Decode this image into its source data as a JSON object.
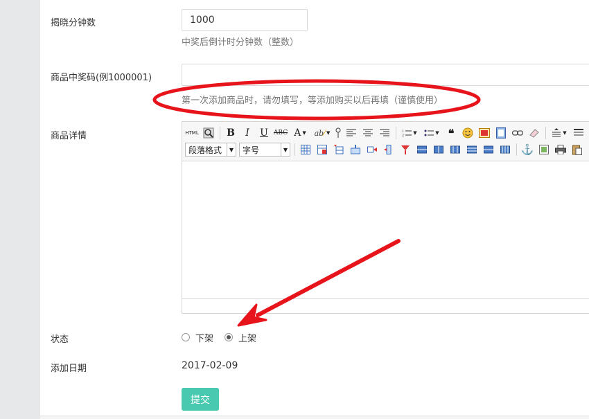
{
  "form": {
    "reveal_minutes": {
      "label": "揭晓分钟数",
      "value": "1000",
      "help": "中奖后倒计时分钟数（整数）"
    },
    "win_code": {
      "label": "商品中奖码(例1000001)",
      "value": "",
      "help": "第一次添加商品时，请勿填写，等添加购买以后再填（谨慎使用）"
    },
    "details": {
      "label": "商品详情",
      "toolbar": {
        "format_select": "段落格式",
        "size_select": "字号",
        "buttons_row1": [
          "html-source",
          "preview",
          "bold",
          "italic",
          "underline",
          "strikethrough",
          "font-color",
          "highlight",
          "insert-point",
          "align-left",
          "align-center",
          "align-right",
          "ordered-list",
          "unordered-list",
          "blockquote",
          "emoticon",
          "image",
          "video",
          "link",
          "eraser",
          "line-height",
          "more"
        ],
        "buttons_row2": [
          "table",
          "table-props",
          "insert-row-before",
          "insert-row",
          "insert-col",
          "merge-cells",
          "split-cells",
          "delete-row",
          "delete-col",
          "table-1",
          "table-2",
          "table-3",
          "table-4",
          "anchor",
          "insert-image",
          "print",
          "paste"
        ]
      }
    },
    "status": {
      "label": "状态",
      "options": [
        {
          "label": "下架",
          "checked": false
        },
        {
          "label": "上架",
          "checked": true
        }
      ]
    },
    "date": {
      "label": "添加日期",
      "value": "2017-02-09"
    },
    "submit_label": "提交"
  },
  "colors": {
    "accent": "#48c9b0",
    "annotation": "#e8141b",
    "sidebar": "#e7e8ea"
  }
}
